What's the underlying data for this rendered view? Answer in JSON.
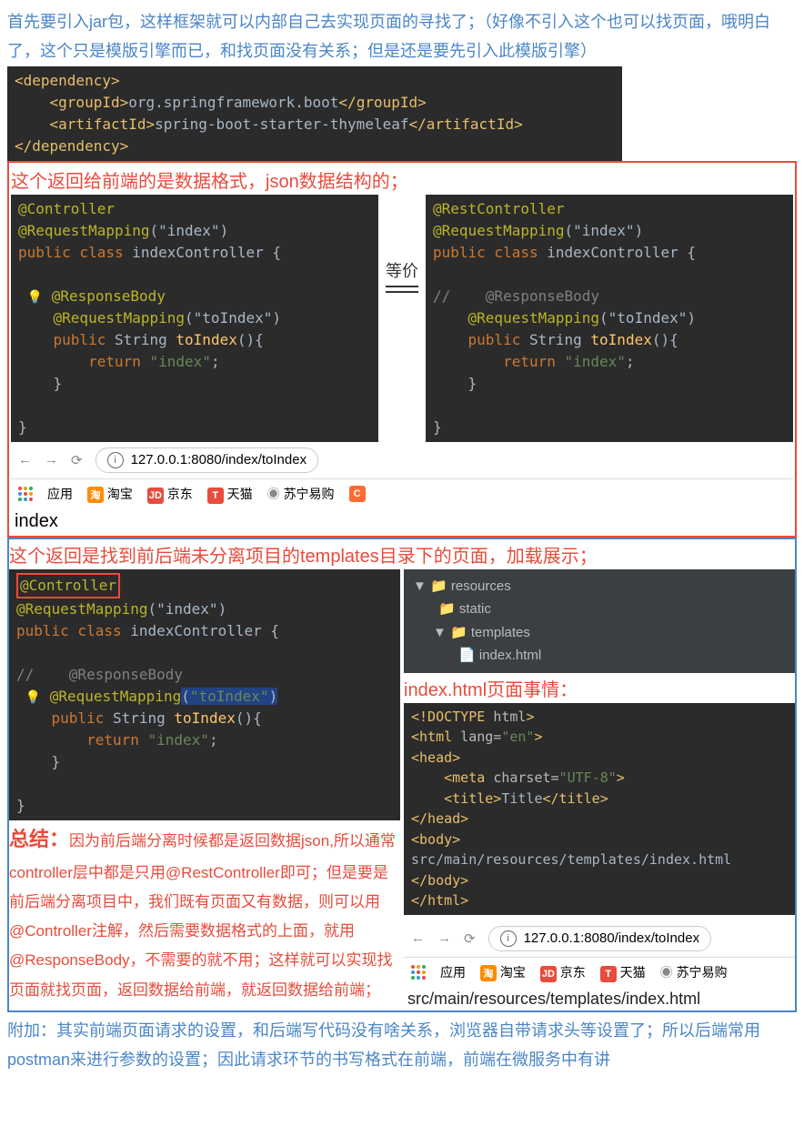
{
  "intro": "首先要引入jar包，这样框架就可以内部自己去实现页面的寻找了；（好像不引入这个也可以找页面，哦明白了，这个只是模版引擎而已，和找页面没有关系；但是还是要先引入此模版引擎）",
  "xml": {
    "dep_open": "<dependency>",
    "group": "    <groupId>org.springframework.boot</groupId>",
    "artifact": "    <artifactId>spring-boot-starter-thymeleaf</artifactId>",
    "dep_close": "</dependency>"
  },
  "redTitle1": "这个返回给前端的是数据格式，json数据结构的；",
  "codeLeft": {
    "l1a": "@Controller",
    "l2a": "@RequestMapping",
    "l2b": "(\"index\")",
    "l3a": "public class ",
    "l3b": "indexController {",
    "l5a": "@ResponseBody",
    "l6a": "@RequestMapping",
    "l6b": "(\"toIndex\")",
    "l7a": "public ",
    "l7b": "String ",
    "l7c": "toIndex",
    "l7d": "(){",
    "l8a": "return ",
    "l8b": "\"index\"",
    "l8c": ";",
    "l9": "    }",
    "l11": "}"
  },
  "equals": "等价",
  "codeRight": {
    "l1a": "@RestController",
    "l2a": "@RequestMapping",
    "l2b": "(\"index\")",
    "l3a": "public class ",
    "l3b": "indexController {",
    "l5c": "//    @ResponseBody",
    "l6a": "@RequestMapping",
    "l6b": "(\"toIndex\")",
    "l7a": "public ",
    "l7b": "String ",
    "l7c": "toIndex",
    "l7d": "(){",
    "l8a": "return ",
    "l8b": "\"index\"",
    "l8c": ";",
    "l9": "    }",
    "l11": "}"
  },
  "url1": "127.0.0.1:8080/index/toIndex",
  "bookmarks": {
    "apps": "应用",
    "tb": "淘宝",
    "jd": "京东",
    "tm": "天猫",
    "sn": "苏宁易购"
  },
  "outputText": "index",
  "blueTitle": "这个返回是找到前后端未分离项目的templates目录下的页面，加载展示；",
  "codeLeft2": {
    "l1a": "@Controller",
    "l2a": "@RequestMapping",
    "l2b": "(\"index\")",
    "l3a": "public class ",
    "l3b": "indexController {",
    "l5c": "//    @ResponseBody",
    "l6a": "@RequestMapping",
    "l6b": "(\"toIndex\")",
    "l7a": "public ",
    "l7b": "String ",
    "l7c": "toIndex",
    "l7d": "(){",
    "l8a": "return ",
    "l8b": "\"index\"",
    "l8c": ";",
    "l9": "    }",
    "l11": "}"
  },
  "tree": {
    "resources": "resources",
    "static": "static",
    "templates": "templates",
    "indexhtml": "index.html"
  },
  "redTitle2": "index.html页面事情：",
  "htmlCode": {
    "l1": "<!DOCTYPE html>",
    "l2": "<html lang=\"en\">",
    "l3": "<head>",
    "l4": "    <meta charset=\"UTF-8\">",
    "l5": "    <title>Title</title>",
    "l6": "</head>",
    "l7": "<body>",
    "l8": "src/main/resources/templates/index.html",
    "l9": "</body>",
    "l10": "</html>"
  },
  "summary": {
    "head": "总结：",
    "body": "因为前后端分离时候都是返回数据json,所以通常controller层中都是只用@RestController即可；但是要是前后端分离项目中，我们既有页面又有数据，则可以用@Controller注解，然后需要数据格式的上面，就用@ResponseBody，不需要的就不用；这样就可以实现找页面就找页面，返回数据给前端，就返回数据给前端；"
  },
  "url2": "127.0.0.1:8080/index/toIndex",
  "pathFooter": "src/main/resources/templates/index.html",
  "footer": "附加：其实前端页面请求的设置，和后端写代码没有啥关系，浏览器自带请求头等设置了；所以后端常用postman来进行参数的设置；因此请求环节的书写格式在前端，前端在微服务中有讲"
}
